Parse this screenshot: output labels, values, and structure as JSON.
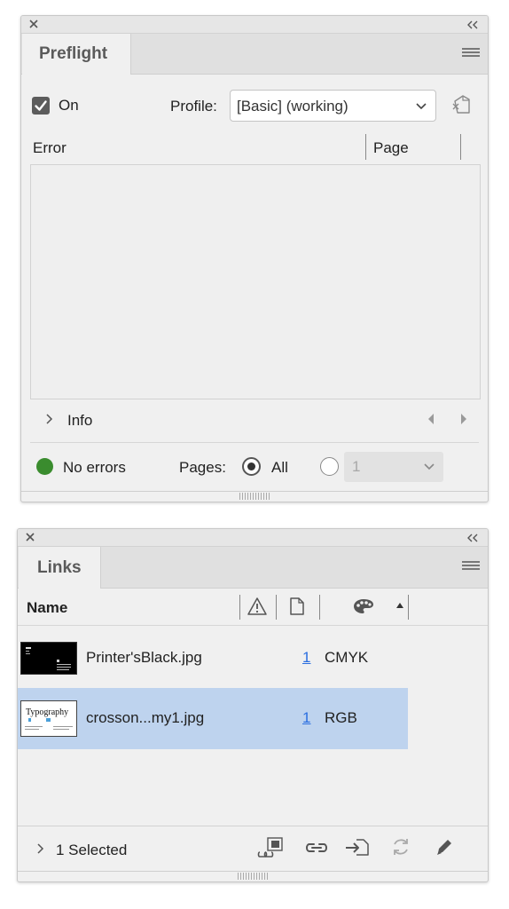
{
  "preflight": {
    "tab_label": "Preflight",
    "on_label": "On",
    "on_checked": true,
    "profile_label": "Profile:",
    "profile_value": "[Basic] (working)",
    "columns": {
      "error": "Error",
      "page": "Page"
    },
    "info_label": "Info",
    "status_text": "No errors",
    "status_color": "#3a8c2e",
    "pages_label": "Pages:",
    "pages_all_label": "All",
    "pages_all_selected": true,
    "page_range_value": "1"
  },
  "links": {
    "tab_label": "Links",
    "columns": {
      "name": "Name"
    },
    "rows": [
      {
        "name": "Printer'sBlack.jpg",
        "page": "1",
        "color_space": "CMYK",
        "selected": false,
        "thumb": "dark-business-card"
      },
      {
        "name": "crosson...my1.jpg",
        "page": "1",
        "color_space": "RGB",
        "selected": true,
        "thumb": "typography-card"
      }
    ],
    "thumb_text": "Typography",
    "selected_summary": "1 Selected",
    "selection_color": "#bed3ee",
    "link_color": "#2a6ee0"
  },
  "icons": {
    "close": "close-x-icon",
    "collapse": "double-chevron-left-icon",
    "menu": "hamburger-menu-icon",
    "define_profiles": "define-profiles-icon",
    "warning": "warning-triangle-icon",
    "page": "page-icon",
    "color": "color-palette-icon",
    "sort": "sort-ascending-icon",
    "relink_from_cc": "relink-from-library-icon",
    "relink": "relink-chain-icon",
    "goto_link": "goto-link-icon",
    "update_link": "update-link-refresh-icon",
    "edit_original": "edit-original-pencil-icon"
  }
}
